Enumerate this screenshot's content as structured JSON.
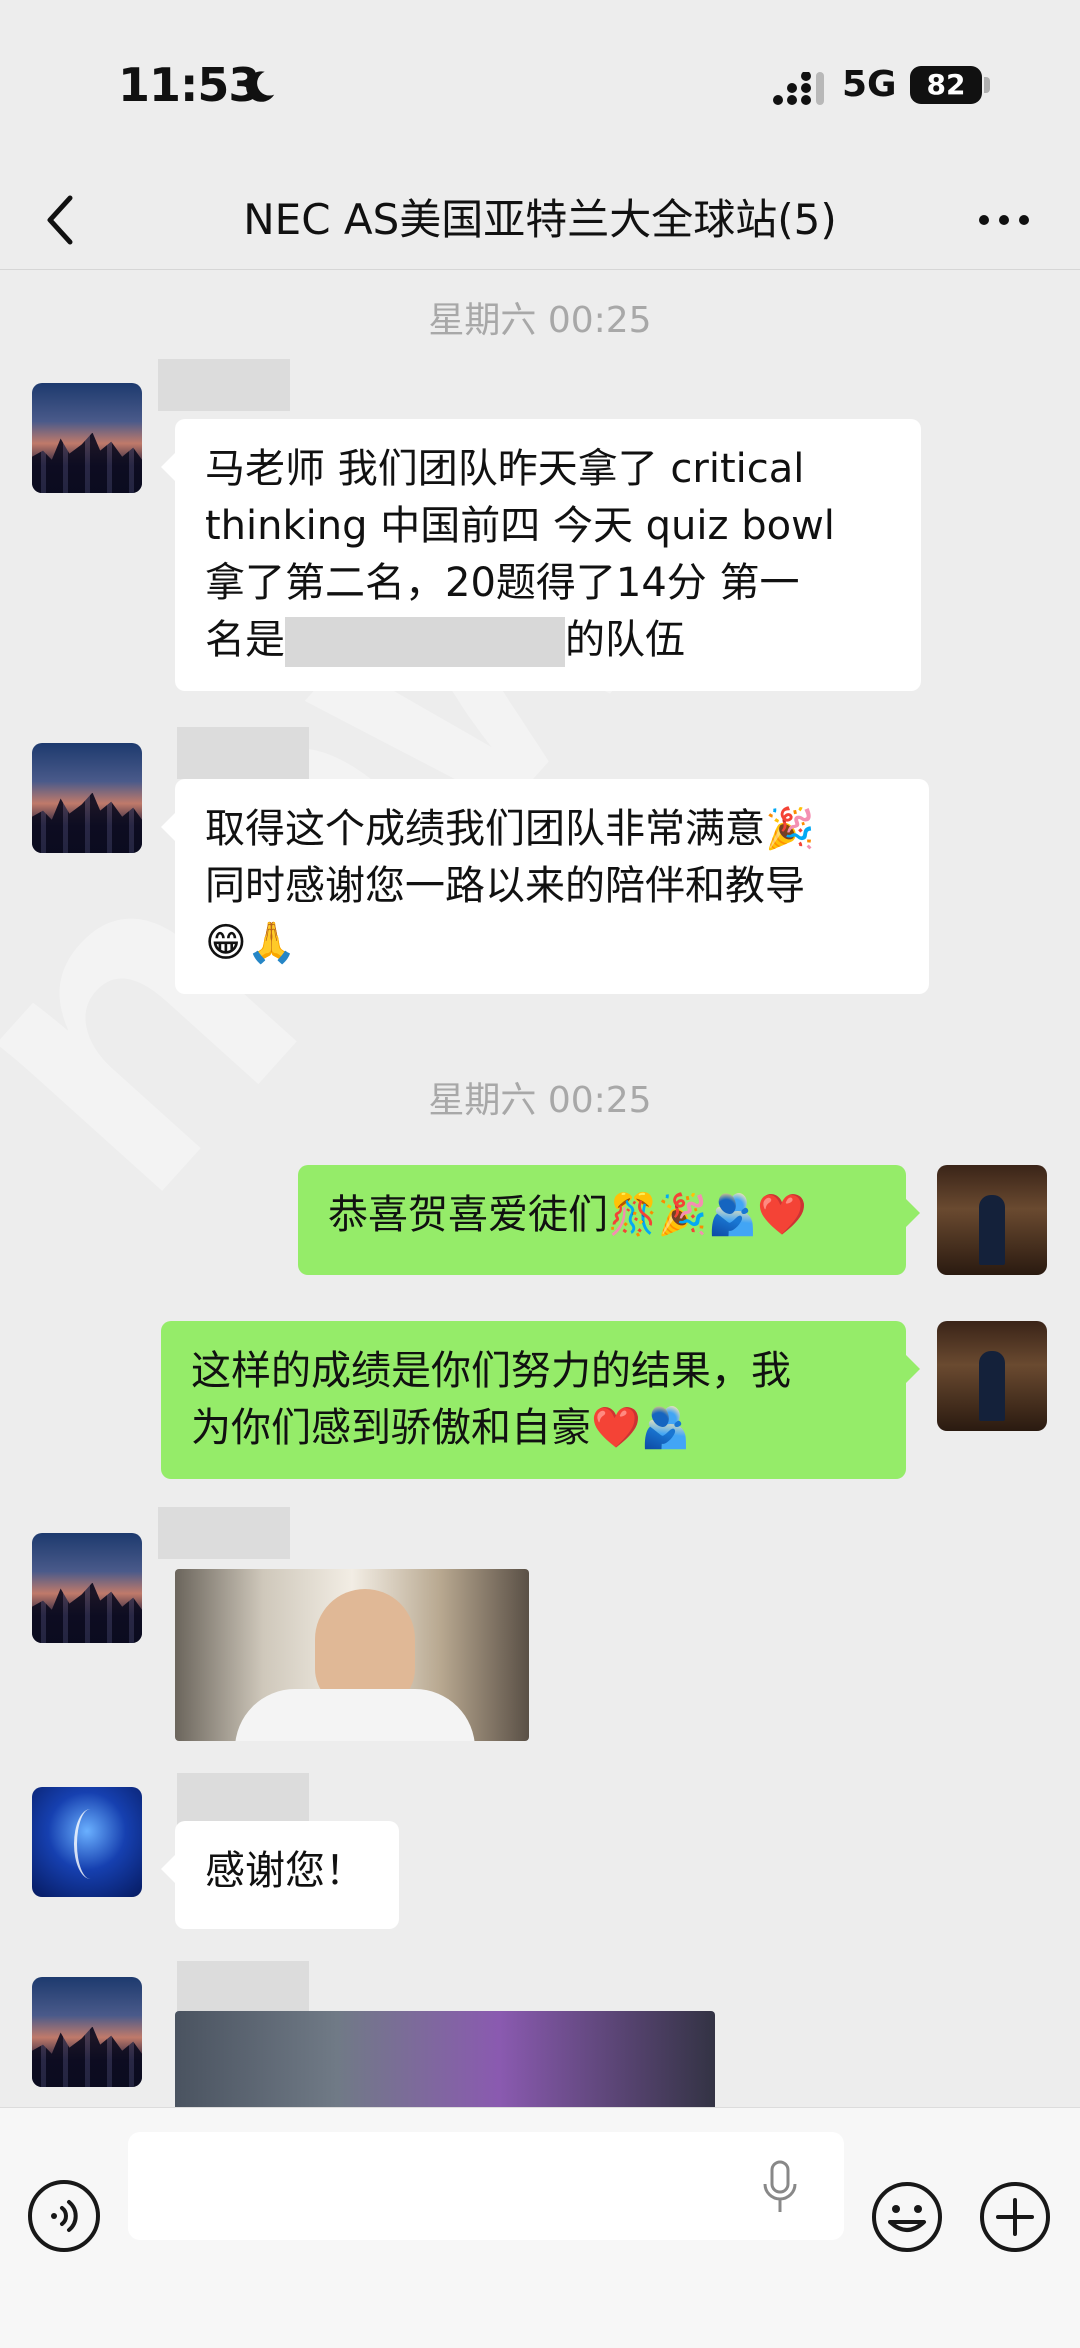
{
  "status_bar": {
    "time": "11:53",
    "network": "5G",
    "battery": "82"
  },
  "nav": {
    "title": "NEC AS美国亚特兰大全球站(5)"
  },
  "chat": {
    "timestamps": [
      "星期六 00:25",
      "星期六 00:25"
    ],
    "messages": [
      {
        "side": "left",
        "lines": [
          "马老师 我们团队昨天拿了 critical",
          "thinking 中国前四 今天 quiz bowl",
          "拿了第二名，20题得了14分  第一",
          "名是",
          "的队伍"
        ]
      },
      {
        "side": "left",
        "lines": [
          "取得这个成绩我们团队非常满意🎉",
          "同时感谢您一路以来的陪伴和教导",
          "😁🙏"
        ]
      },
      {
        "side": "right",
        "text": "恭喜贺喜爱徒们🎊🎉🫂❤️"
      },
      {
        "side": "right",
        "lines": [
          "这样的成绩是你们努力的结果，我",
          "为你们感到骄傲和自豪❤️🫂"
        ]
      },
      {
        "side": "left",
        "text": "感谢您！"
      }
    ]
  },
  "input": {
    "placeholder": ""
  },
  "watermark": "new"
}
